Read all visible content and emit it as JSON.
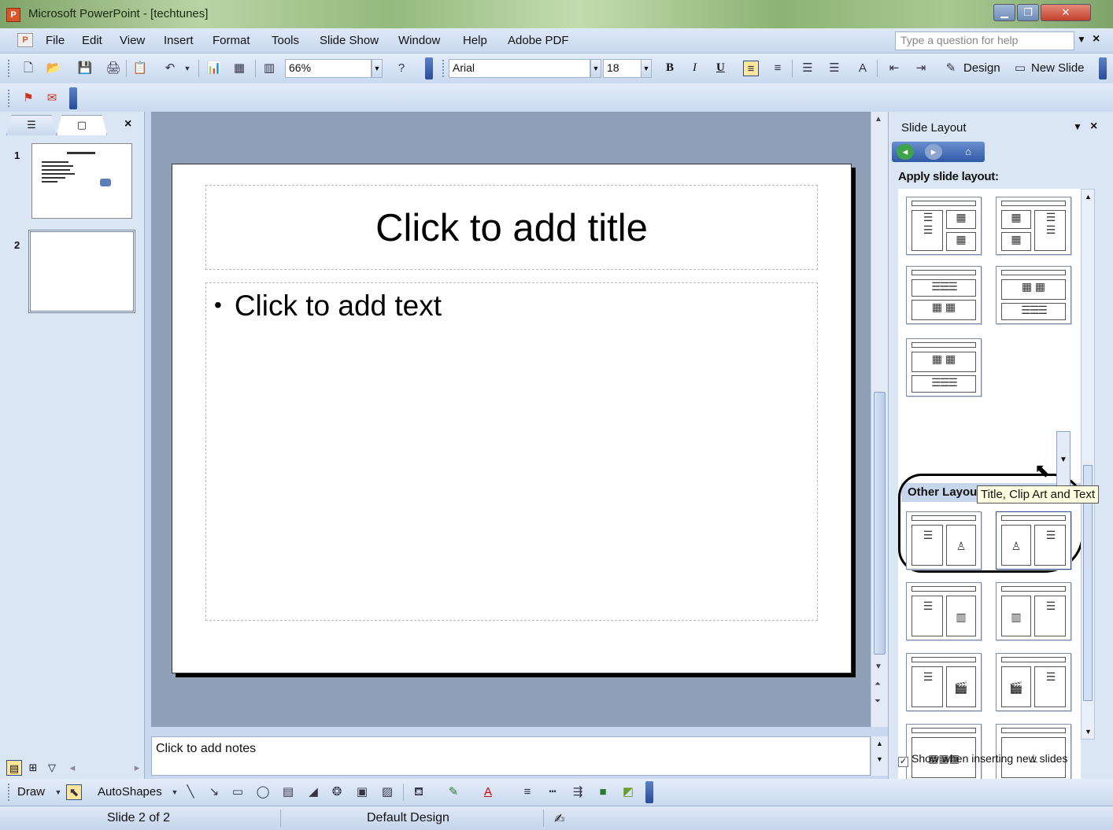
{
  "window": {
    "title": "Microsoft PowerPoint - [techtunes]",
    "minimize_icon": "minimize-icon",
    "maximize_icon": "restore-icon",
    "close_icon": "close-icon"
  },
  "menu": {
    "items": [
      "File",
      "Edit",
      "View",
      "Insert",
      "Format",
      "Tools",
      "Slide Show",
      "Window",
      "Help",
      "Adobe PDF"
    ],
    "help_placeholder": "Type a question for help"
  },
  "toolbar": {
    "zoom": "66%",
    "font": "Arial",
    "font_size": "18",
    "bold": "B",
    "italic": "I",
    "underline": "U",
    "design_label": "Design",
    "new_slide_label": "New Slide"
  },
  "slides_panel": {
    "slide_numbers": [
      "1",
      "2"
    ]
  },
  "slide": {
    "title_placeholder": "Click to add title",
    "body_placeholder": "Click to add text"
  },
  "notes": {
    "placeholder": "Click to add notes"
  },
  "task_pane": {
    "title": "Slide Layout",
    "apply_label": "Apply slide layout:",
    "other_layouts_label": "Other Layouts",
    "tooltip": "Title, Clip Art and Text",
    "show_checkbox_label": "Show when inserting new slides",
    "show_checkbox_checked": true
  },
  "draw_toolbar": {
    "draw_label": "Draw",
    "autoshapes_label": "AutoShapes"
  },
  "statusbar": {
    "slide_position": "Slide 2 of 2",
    "design": "Default Design"
  },
  "colors": {
    "slide_area_bg": "#8f9fb8",
    "toolbar_bg": "#c9d9ef",
    "task_pane_bg": "#dbe6f5"
  }
}
